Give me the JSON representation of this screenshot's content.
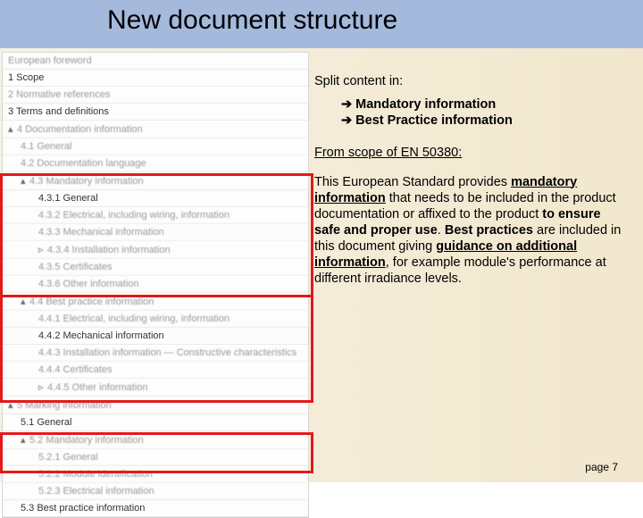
{
  "title": "New document structure",
  "toc": [
    {
      "txt": "European foreword",
      "cls": "blur"
    },
    {
      "txt": "1 Scope",
      "cls": ""
    },
    {
      "txt": "2 Normative references",
      "cls": "blur"
    },
    {
      "txt": "3 Terms and definitions",
      "cls": ""
    },
    {
      "tri": "▴",
      "txt": "4 Documentation information",
      "cls": "blur"
    },
    {
      "txt": "4.1 General",
      "cls": "blur ind1"
    },
    {
      "txt": "4.2 Documentation language",
      "cls": "blur ind1"
    },
    {
      "tri": "▴",
      "txt": "4.3 Mandatory information",
      "cls": "blur ind1"
    },
    {
      "txt": "4.3.1 General",
      "cls": "ind2"
    },
    {
      "txt": "4.3.2 Electrical, including wiring, information",
      "cls": "blur ind2"
    },
    {
      "txt": "4.3.3 Mechanical information",
      "cls": "blur ind2"
    },
    {
      "tri": "▹",
      "txt": "4.3.4 Installation information",
      "cls": "blur ind2"
    },
    {
      "txt": "4.3.5 Certificates",
      "cls": "blur ind2"
    },
    {
      "txt": "4.3.6 Other information",
      "cls": "blur ind2"
    },
    {
      "tri": "▴",
      "txt": "4.4 Best practice information",
      "cls": "blur ind1"
    },
    {
      "txt": "4.4.1 Electrical, including wiring, information",
      "cls": "blur ind2"
    },
    {
      "txt": "4.4.2 Mechanical information",
      "cls": "ind2"
    },
    {
      "txt": "4.4.3 Installation information — Constructive characteristics",
      "cls": "blur ind2"
    },
    {
      "txt": "4.4.4 Certificates",
      "cls": "blur ind2"
    },
    {
      "tri": "▹",
      "txt": "4.4.5 Other information",
      "cls": "blur ind2"
    },
    {
      "tri": "▴",
      "txt": "5 Marking information",
      "cls": "blur"
    },
    {
      "txt": "5.1 General",
      "cls": "ind1"
    },
    {
      "tri": "▴",
      "txt": "5.2 Mandatory information",
      "cls": "blur ind1"
    },
    {
      "txt": "5.2.1 General",
      "cls": "blur ind2"
    },
    {
      "txt": "5.2.2 Module identification",
      "cls": "blur ind2"
    },
    {
      "txt": "5.2.3 Electrical information",
      "cls": "blur ind2"
    },
    {
      "txt": "5.3 Best practice information",
      "cls": "ind1"
    }
  ],
  "content": {
    "lead": "Split content in:",
    "bullets": [
      "Mandatory information",
      "Best Practice information"
    ],
    "scopeLine": "From scope of EN 50380:",
    "para_plain1": "This European Standard provides ",
    "para_bu1": "mandatory information",
    "para_plain2": " that needs to be included in the product documentation or affixed to the product ",
    "para_b1": "to ensure safe and proper use",
    "para_plain3": ". ",
    "para_b2": "Best practices",
    "para_plain4": " are included in this document giving ",
    "para_bu2": "guidance on additional information",
    "para_plain5": ", for example module's performance at different irradiance levels."
  },
  "pageNum": "page 7"
}
